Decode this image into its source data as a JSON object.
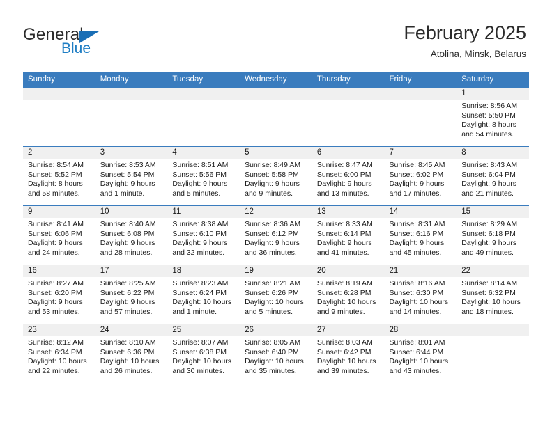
{
  "brand": {
    "name_part1": "General",
    "name_part2": "Blue"
  },
  "header": {
    "title": "February 2025",
    "subtitle": "Atolina, Minsk, Belarus"
  },
  "colors": {
    "header_blue": "#3a7cbe",
    "logo_blue": "#1f7ec4",
    "daynum_band": "#f0f0f0"
  },
  "weekday_headers": [
    "Sunday",
    "Monday",
    "Tuesday",
    "Wednesday",
    "Thursday",
    "Friday",
    "Saturday"
  ],
  "weeks": [
    [
      {
        "day": "",
        "empty": true
      },
      {
        "day": "",
        "empty": true
      },
      {
        "day": "",
        "empty": true
      },
      {
        "day": "",
        "empty": true
      },
      {
        "day": "",
        "empty": true
      },
      {
        "day": "",
        "empty": true
      },
      {
        "day": "1",
        "sunrise": "Sunrise: 8:56 AM",
        "sunset": "Sunset: 5:50 PM",
        "daylight_line1": "Daylight: 8 hours",
        "daylight_line2": "and 54 minutes."
      }
    ],
    [
      {
        "day": "2",
        "sunrise": "Sunrise: 8:54 AM",
        "sunset": "Sunset: 5:52 PM",
        "daylight_line1": "Daylight: 8 hours",
        "daylight_line2": "and 58 minutes."
      },
      {
        "day": "3",
        "sunrise": "Sunrise: 8:53 AM",
        "sunset": "Sunset: 5:54 PM",
        "daylight_line1": "Daylight: 9 hours",
        "daylight_line2": "and 1 minute."
      },
      {
        "day": "4",
        "sunrise": "Sunrise: 8:51 AM",
        "sunset": "Sunset: 5:56 PM",
        "daylight_line1": "Daylight: 9 hours",
        "daylight_line2": "and 5 minutes."
      },
      {
        "day": "5",
        "sunrise": "Sunrise: 8:49 AM",
        "sunset": "Sunset: 5:58 PM",
        "daylight_line1": "Daylight: 9 hours",
        "daylight_line2": "and 9 minutes."
      },
      {
        "day": "6",
        "sunrise": "Sunrise: 8:47 AM",
        "sunset": "Sunset: 6:00 PM",
        "daylight_line1": "Daylight: 9 hours",
        "daylight_line2": "and 13 minutes."
      },
      {
        "day": "7",
        "sunrise": "Sunrise: 8:45 AM",
        "sunset": "Sunset: 6:02 PM",
        "daylight_line1": "Daylight: 9 hours",
        "daylight_line2": "and 17 minutes."
      },
      {
        "day": "8",
        "sunrise": "Sunrise: 8:43 AM",
        "sunset": "Sunset: 6:04 PM",
        "daylight_line1": "Daylight: 9 hours",
        "daylight_line2": "and 21 minutes."
      }
    ],
    [
      {
        "day": "9",
        "sunrise": "Sunrise: 8:41 AM",
        "sunset": "Sunset: 6:06 PM",
        "daylight_line1": "Daylight: 9 hours",
        "daylight_line2": "and 24 minutes."
      },
      {
        "day": "10",
        "sunrise": "Sunrise: 8:40 AM",
        "sunset": "Sunset: 6:08 PM",
        "daylight_line1": "Daylight: 9 hours",
        "daylight_line2": "and 28 minutes."
      },
      {
        "day": "11",
        "sunrise": "Sunrise: 8:38 AM",
        "sunset": "Sunset: 6:10 PM",
        "daylight_line1": "Daylight: 9 hours",
        "daylight_line2": "and 32 minutes."
      },
      {
        "day": "12",
        "sunrise": "Sunrise: 8:36 AM",
        "sunset": "Sunset: 6:12 PM",
        "daylight_line1": "Daylight: 9 hours",
        "daylight_line2": "and 36 minutes."
      },
      {
        "day": "13",
        "sunrise": "Sunrise: 8:33 AM",
        "sunset": "Sunset: 6:14 PM",
        "daylight_line1": "Daylight: 9 hours",
        "daylight_line2": "and 41 minutes."
      },
      {
        "day": "14",
        "sunrise": "Sunrise: 8:31 AM",
        "sunset": "Sunset: 6:16 PM",
        "daylight_line1": "Daylight: 9 hours",
        "daylight_line2": "and 45 minutes."
      },
      {
        "day": "15",
        "sunrise": "Sunrise: 8:29 AM",
        "sunset": "Sunset: 6:18 PM",
        "daylight_line1": "Daylight: 9 hours",
        "daylight_line2": "and 49 minutes."
      }
    ],
    [
      {
        "day": "16",
        "sunrise": "Sunrise: 8:27 AM",
        "sunset": "Sunset: 6:20 PM",
        "daylight_line1": "Daylight: 9 hours",
        "daylight_line2": "and 53 minutes."
      },
      {
        "day": "17",
        "sunrise": "Sunrise: 8:25 AM",
        "sunset": "Sunset: 6:22 PM",
        "daylight_line1": "Daylight: 9 hours",
        "daylight_line2": "and 57 minutes."
      },
      {
        "day": "18",
        "sunrise": "Sunrise: 8:23 AM",
        "sunset": "Sunset: 6:24 PM",
        "daylight_line1": "Daylight: 10 hours",
        "daylight_line2": "and 1 minute."
      },
      {
        "day": "19",
        "sunrise": "Sunrise: 8:21 AM",
        "sunset": "Sunset: 6:26 PM",
        "daylight_line1": "Daylight: 10 hours",
        "daylight_line2": "and 5 minutes."
      },
      {
        "day": "20",
        "sunrise": "Sunrise: 8:19 AM",
        "sunset": "Sunset: 6:28 PM",
        "daylight_line1": "Daylight: 10 hours",
        "daylight_line2": "and 9 minutes."
      },
      {
        "day": "21",
        "sunrise": "Sunrise: 8:16 AM",
        "sunset": "Sunset: 6:30 PM",
        "daylight_line1": "Daylight: 10 hours",
        "daylight_line2": "and 14 minutes."
      },
      {
        "day": "22",
        "sunrise": "Sunrise: 8:14 AM",
        "sunset": "Sunset: 6:32 PM",
        "daylight_line1": "Daylight: 10 hours",
        "daylight_line2": "and 18 minutes."
      }
    ],
    [
      {
        "day": "23",
        "sunrise": "Sunrise: 8:12 AM",
        "sunset": "Sunset: 6:34 PM",
        "daylight_line1": "Daylight: 10 hours",
        "daylight_line2": "and 22 minutes."
      },
      {
        "day": "24",
        "sunrise": "Sunrise: 8:10 AM",
        "sunset": "Sunset: 6:36 PM",
        "daylight_line1": "Daylight: 10 hours",
        "daylight_line2": "and 26 minutes."
      },
      {
        "day": "25",
        "sunrise": "Sunrise: 8:07 AM",
        "sunset": "Sunset: 6:38 PM",
        "daylight_line1": "Daylight: 10 hours",
        "daylight_line2": "and 30 minutes."
      },
      {
        "day": "26",
        "sunrise": "Sunrise: 8:05 AM",
        "sunset": "Sunset: 6:40 PM",
        "daylight_line1": "Daylight: 10 hours",
        "daylight_line2": "and 35 minutes."
      },
      {
        "day": "27",
        "sunrise": "Sunrise: 8:03 AM",
        "sunset": "Sunset: 6:42 PM",
        "daylight_line1": "Daylight: 10 hours",
        "daylight_line2": "and 39 minutes."
      },
      {
        "day": "28",
        "sunrise": "Sunrise: 8:01 AM",
        "sunset": "Sunset: 6:44 PM",
        "daylight_line1": "Daylight: 10 hours",
        "daylight_line2": "and 43 minutes."
      },
      {
        "day": "",
        "empty": true
      }
    ]
  ]
}
